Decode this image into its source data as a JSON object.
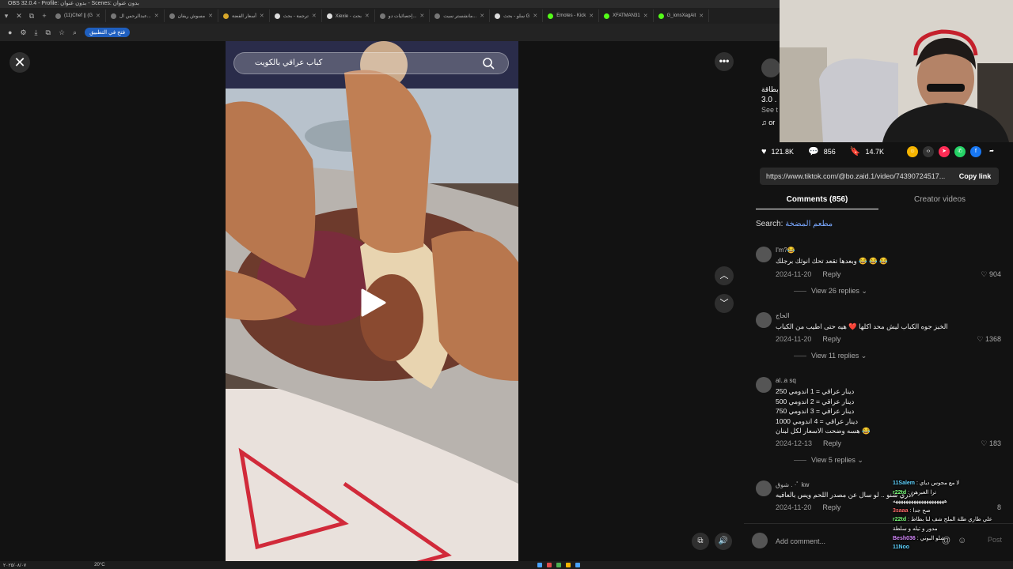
{
  "obs_title": "OBS 32.0.4 - Profile: بدون عنوان - Scenes: بدون عنوان",
  "tabs": [
    {
      "label": "(11)Chef || (G",
      "icon": "tiktok-icon"
    },
    {
      "label": "عبدالرحمن ال...",
      "icon": "tiktok-icon"
    },
    {
      "label": "مسوش ريفان",
      "icon": "globe-icon"
    },
    {
      "label": "أسعار الفضة",
      "icon": "coin-icon"
    },
    {
      "label": "ترجمة - بحث",
      "icon": "google-icon"
    },
    {
      "label": "Xiexie - بحث",
      "icon": "google-icon"
    },
    {
      "label": "إحصائيات دو...",
      "icon": "globe-icon"
    },
    {
      "label": "مانشستر سيت...",
      "icon": "globe-icon"
    },
    {
      "label": "سلو - بحث G",
      "icon": "google-icon"
    },
    {
      "label": "Emotes - Kick",
      "icon": "kick-icon"
    },
    {
      "label": "XFATMAN31",
      "icon": "kick-icon"
    },
    {
      "label": "G_ionsXagAit",
      "icon": "kick-icon"
    }
  ],
  "toolbar": {
    "open_in_app": "فتح في التطبيق"
  },
  "video": {
    "search_text": "كباب عراقي بالكويت"
  },
  "panel": {
    "caption_fragment_1": "بطاقة .",
    "caption_fragment_2": "3.0 .",
    "caption_fragment_3": "See t",
    "music_fragment": "or",
    "likes": "121.8K",
    "comments_count": "856",
    "saves": "14.7K",
    "link": "https://www.tiktok.com/@bo.zaid.1/video/74390724517...",
    "copy_link": "Copy link",
    "tab_comments": "Comments (856)",
    "tab_creator": "Creator videos",
    "search_label": "Search:",
    "search_query": "مطعم المضخة",
    "add_comment": "Add comment...",
    "post": "Post"
  },
  "comments": [
    {
      "user": "I'm?😂",
      "text": "وبعدها تقعد تحك انوثك برجلك 😂 😂 😂",
      "date": "2024-11-20",
      "reply": "Reply",
      "likes": "904",
      "replies": "View 26 replies"
    },
    {
      "user": "الحاج",
      "text": "الخبز جوه الكباب ليش محد اكلها ❤️ هيه حتى اطيب من الكباب",
      "date": "2024-11-20",
      "reply": "Reply",
      "likes": "1368",
      "replies": "View 11 replies"
    },
    {
      "user": "al..a sq",
      "text": "250 دينار عراقي = 1 اندومي\n500 دينار عراقي = 2 اندومي\n750 دينار عراقي = 3 اندومي\n1000 دينار عراقي = 4 اندومي\nهسه وضحت الاسعار لكل لبنان 😂",
      "date": "2024-12-13",
      "reply": "Reply",
      "likes": "183",
      "replies": "View 5 replies"
    },
    {
      "user": "شوق . ·ﾟ kw",
      "text": "ادري شنو .. لو سال عن مصدر اللحم ويس بالعافيه",
      "date": "2024-11-20",
      "reply": "Reply",
      "likes": "8",
      "replies": ""
    }
  ],
  "chat": [
    {
      "user": "11Salem",
      "msg": "لا مع مجوس دياي",
      "color": "#5fd3ff"
    },
    {
      "user": "r22td",
      "msg": "ترا العبرهن",
      "color": "#7cff7c"
    },
    {
      "user": "",
      "msg": "ههههههههههههههههههههه",
      "color": "#ffffff"
    },
    {
      "user": "3saaa",
      "msg": "صح جدا",
      "color": "#ff6b6b"
    },
    {
      "user": "r22td",
      "msg": "علي طاري طلة الملح شف لنا بطاط",
      "color": "#7cff7c"
    },
    {
      "user": "",
      "msg": "مدور و تيله و سلطة",
      "color": "#ffffff"
    },
    {
      "user": "Besh036",
      "msg": "شلو البوني",
      "color": "#d78bff"
    },
    {
      "user": "11Noo",
      "msg": "",
      "color": "#5fd3ff"
    }
  ],
  "taskbar": {
    "weather": "20°C",
    "clock": "٢٠٢٥/٠٨/٠٧"
  }
}
